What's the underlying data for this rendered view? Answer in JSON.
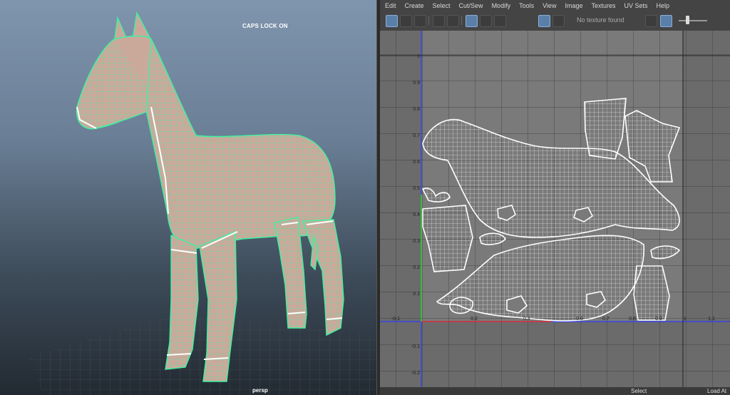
{
  "viewport": {
    "caps_lock": "CAPS LOCK ON",
    "camera": "persp"
  },
  "uv_editor": {
    "menu": [
      "Edit",
      "Create",
      "Select",
      "Cut/Sew",
      "Modify",
      "Tools",
      "View",
      "Image",
      "Textures",
      "UV Sets",
      "Help"
    ],
    "texture_dropdown": "No texture found",
    "axis_labels": {
      "v": [
        "1",
        "0.9",
        "0.8",
        "0.7",
        "0.6",
        "0.5",
        "0.4",
        "0.3",
        "0.2",
        "0.1",
        "-0.1",
        "-0.2"
      ],
      "u": [
        "-0.1",
        "0.2",
        "0.4",
        "0.6",
        "0.7",
        "0.8",
        "0.9",
        "1",
        "1.1"
      ]
    },
    "status": {
      "left": "Select",
      "right": "Load At"
    }
  },
  "colors": {
    "viewport_top": "#7f95ad",
    "mesh_wire": "#3df2a0",
    "body": "#caa99b",
    "uv_bg": "#6b6b6b",
    "uv_shell": "#ffffff",
    "axis_blue": "#2c3cff",
    "axis_red": "#e03030",
    "axis_green": "#30d030"
  }
}
